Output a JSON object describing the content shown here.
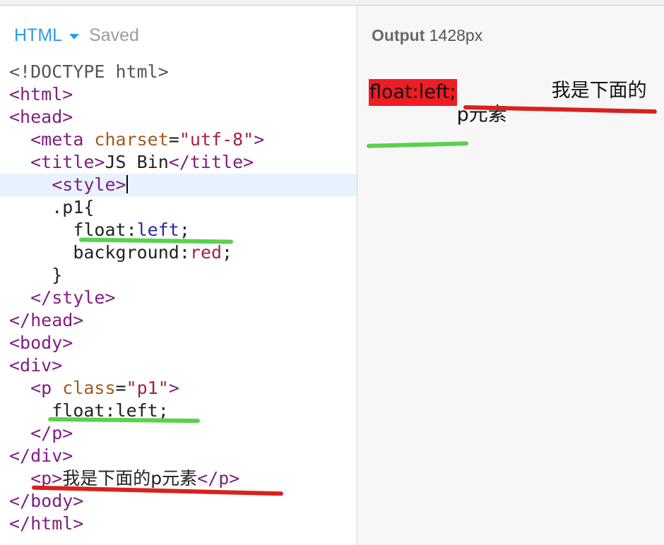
{
  "editor": {
    "language": "HTML",
    "status": "Saved",
    "code": {
      "doctype": "<!DOCTYPE html>",
      "html_open": "<html>",
      "head_open": "<head>",
      "meta_lt": "<meta",
      "meta_attr": " charset",
      "meta_eq": "=",
      "meta_val": "\"utf-8\"",
      "meta_gt": ">",
      "title_open": "<title>",
      "title_text": "JS Bin",
      "title_close": "</title>",
      "style_open": "<style>",
      "selector": ".p1{",
      "prop1": "float:",
      "val1": "left",
      "semi1": ";",
      "prop2": "background:",
      "val2": "red",
      "semi2": ";",
      "brace_close": "}",
      "style_close": "</style>",
      "head_close": "</head>",
      "body_open": "<body>",
      "div_open": "<div>",
      "p_lt": "<p",
      "p_attr": " class",
      "p_eq": "=",
      "p_val": "\"p1\"",
      "p_gt": ">",
      "p_text": "float:left;",
      "p_close": "</p>",
      "div_close": "</div>",
      "p2_open": "<p>",
      "p2_text": "我是下面的p元素",
      "p2_close": "</p>",
      "body_close": "</body>",
      "html_close": "</html>"
    }
  },
  "output": {
    "label": "Output",
    "width_text": "1428px",
    "float_text": "float:left;",
    "para_text": "我是下面的p元素"
  },
  "colors": {
    "accent": "#2f9be4",
    "float_bg": "#ee1c24",
    "green_mark": "#5bd14f",
    "red_mark": "#d9211d"
  }
}
